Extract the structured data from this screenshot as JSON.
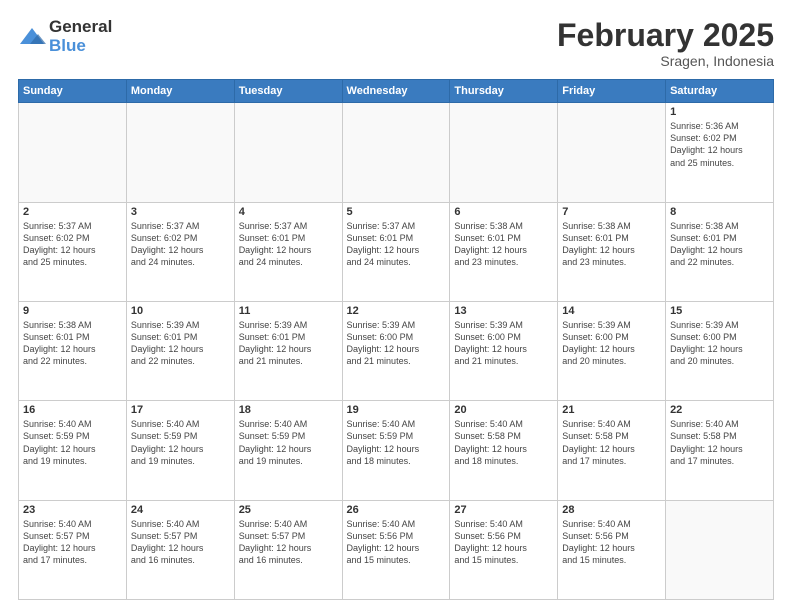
{
  "logo": {
    "general": "General",
    "blue": "Blue"
  },
  "title": {
    "month": "February 2025",
    "location": "Sragen, Indonesia"
  },
  "weekdays": [
    "Sunday",
    "Monday",
    "Tuesday",
    "Wednesday",
    "Thursday",
    "Friday",
    "Saturday"
  ],
  "weeks": [
    [
      {
        "day": "",
        "info": ""
      },
      {
        "day": "",
        "info": ""
      },
      {
        "day": "",
        "info": ""
      },
      {
        "day": "",
        "info": ""
      },
      {
        "day": "",
        "info": ""
      },
      {
        "day": "",
        "info": ""
      },
      {
        "day": "1",
        "info": "Sunrise: 5:36 AM\nSunset: 6:02 PM\nDaylight: 12 hours\nand 25 minutes."
      }
    ],
    [
      {
        "day": "2",
        "info": "Sunrise: 5:37 AM\nSunset: 6:02 PM\nDaylight: 12 hours\nand 25 minutes."
      },
      {
        "day": "3",
        "info": "Sunrise: 5:37 AM\nSunset: 6:02 PM\nDaylight: 12 hours\nand 24 minutes."
      },
      {
        "day": "4",
        "info": "Sunrise: 5:37 AM\nSunset: 6:01 PM\nDaylight: 12 hours\nand 24 minutes."
      },
      {
        "day": "5",
        "info": "Sunrise: 5:37 AM\nSunset: 6:01 PM\nDaylight: 12 hours\nand 24 minutes."
      },
      {
        "day": "6",
        "info": "Sunrise: 5:38 AM\nSunset: 6:01 PM\nDaylight: 12 hours\nand 23 minutes."
      },
      {
        "day": "7",
        "info": "Sunrise: 5:38 AM\nSunset: 6:01 PM\nDaylight: 12 hours\nand 23 minutes."
      },
      {
        "day": "8",
        "info": "Sunrise: 5:38 AM\nSunset: 6:01 PM\nDaylight: 12 hours\nand 22 minutes."
      }
    ],
    [
      {
        "day": "9",
        "info": "Sunrise: 5:38 AM\nSunset: 6:01 PM\nDaylight: 12 hours\nand 22 minutes."
      },
      {
        "day": "10",
        "info": "Sunrise: 5:39 AM\nSunset: 6:01 PM\nDaylight: 12 hours\nand 22 minutes."
      },
      {
        "day": "11",
        "info": "Sunrise: 5:39 AM\nSunset: 6:01 PM\nDaylight: 12 hours\nand 21 minutes."
      },
      {
        "day": "12",
        "info": "Sunrise: 5:39 AM\nSunset: 6:00 PM\nDaylight: 12 hours\nand 21 minutes."
      },
      {
        "day": "13",
        "info": "Sunrise: 5:39 AM\nSunset: 6:00 PM\nDaylight: 12 hours\nand 21 minutes."
      },
      {
        "day": "14",
        "info": "Sunrise: 5:39 AM\nSunset: 6:00 PM\nDaylight: 12 hours\nand 20 minutes."
      },
      {
        "day": "15",
        "info": "Sunrise: 5:39 AM\nSunset: 6:00 PM\nDaylight: 12 hours\nand 20 minutes."
      }
    ],
    [
      {
        "day": "16",
        "info": "Sunrise: 5:40 AM\nSunset: 5:59 PM\nDaylight: 12 hours\nand 19 minutes."
      },
      {
        "day": "17",
        "info": "Sunrise: 5:40 AM\nSunset: 5:59 PM\nDaylight: 12 hours\nand 19 minutes."
      },
      {
        "day": "18",
        "info": "Sunrise: 5:40 AM\nSunset: 5:59 PM\nDaylight: 12 hours\nand 19 minutes."
      },
      {
        "day": "19",
        "info": "Sunrise: 5:40 AM\nSunset: 5:59 PM\nDaylight: 12 hours\nand 18 minutes."
      },
      {
        "day": "20",
        "info": "Sunrise: 5:40 AM\nSunset: 5:58 PM\nDaylight: 12 hours\nand 18 minutes."
      },
      {
        "day": "21",
        "info": "Sunrise: 5:40 AM\nSunset: 5:58 PM\nDaylight: 12 hours\nand 17 minutes."
      },
      {
        "day": "22",
        "info": "Sunrise: 5:40 AM\nSunset: 5:58 PM\nDaylight: 12 hours\nand 17 minutes."
      }
    ],
    [
      {
        "day": "23",
        "info": "Sunrise: 5:40 AM\nSunset: 5:57 PM\nDaylight: 12 hours\nand 17 minutes."
      },
      {
        "day": "24",
        "info": "Sunrise: 5:40 AM\nSunset: 5:57 PM\nDaylight: 12 hours\nand 16 minutes."
      },
      {
        "day": "25",
        "info": "Sunrise: 5:40 AM\nSunset: 5:57 PM\nDaylight: 12 hours\nand 16 minutes."
      },
      {
        "day": "26",
        "info": "Sunrise: 5:40 AM\nSunset: 5:56 PM\nDaylight: 12 hours\nand 15 minutes."
      },
      {
        "day": "27",
        "info": "Sunrise: 5:40 AM\nSunset: 5:56 PM\nDaylight: 12 hours\nand 15 minutes."
      },
      {
        "day": "28",
        "info": "Sunrise: 5:40 AM\nSunset: 5:56 PM\nDaylight: 12 hours\nand 15 minutes."
      },
      {
        "day": "",
        "info": ""
      }
    ]
  ]
}
